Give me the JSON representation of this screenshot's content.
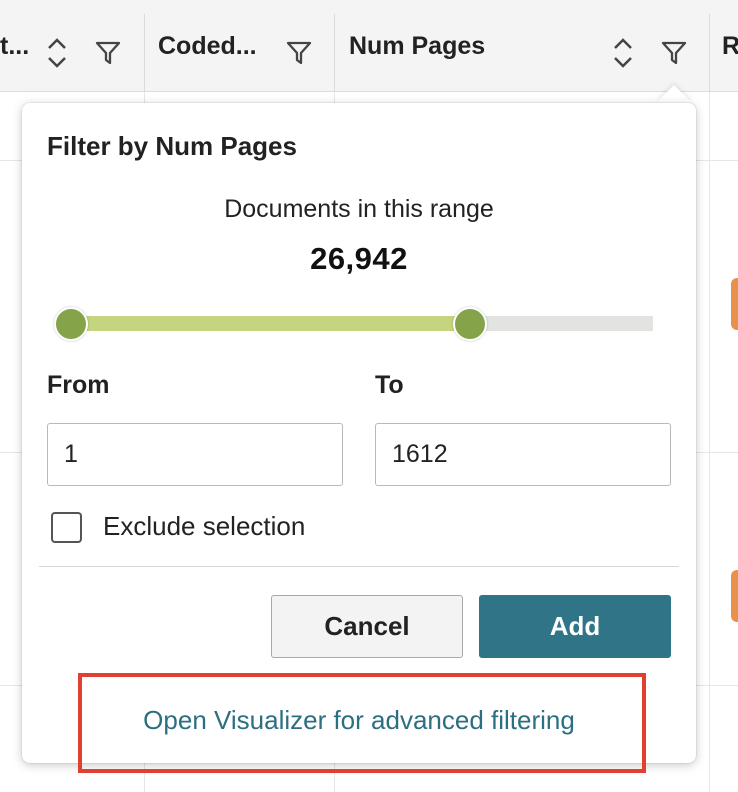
{
  "table": {
    "columns": [
      {
        "label": "t..."
      },
      {
        "label": "Coded..."
      },
      {
        "label": "Num Pages"
      },
      {
        "label": "R"
      }
    ]
  },
  "filter_popover": {
    "title": "Filter by Num Pages",
    "range_label": "Documents in this range",
    "document_count": "26,942",
    "slider": {
      "min_fraction": 0.0,
      "max_fraction": 0.69
    },
    "from_label": "From",
    "from_value": "1",
    "to_label": "To",
    "to_value": "1612",
    "exclude_label": "Exclude selection",
    "exclude_checked": false,
    "cancel_label": "Cancel",
    "add_label": "Add",
    "visualizer_link": "Open Visualizer for advanced filtering"
  },
  "colors": {
    "accent": "#2f7587",
    "slider_fill": "#c4d47f",
    "slider_handle": "#85a44a",
    "link": "#2c6f82",
    "highlight": "#e0402f"
  },
  "icons": [
    "sort-icon",
    "filter-icon"
  ]
}
